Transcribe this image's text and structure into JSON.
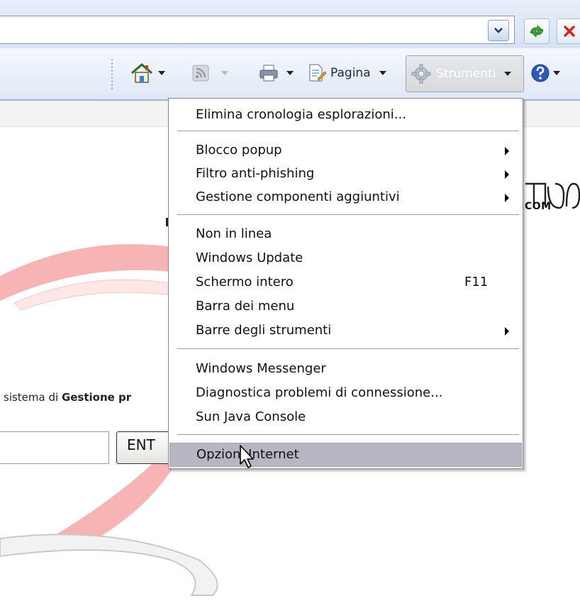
{
  "toolbar": {
    "page_label": "Pagina",
    "tools_label": "Strumenti"
  },
  "page": {
    "text_prefix": "sistema di ",
    "text_bold": "Gestione pr",
    "enter_button": "ENT",
    "logo_text": "COM"
  },
  "menu": {
    "items": [
      {
        "label": "Elimina cronologia esplorazioni..."
      },
      {
        "label": "Blocco popup"
      },
      {
        "label": "Filtro anti-phishing"
      },
      {
        "label": "Gestione componenti aggiuntivi"
      },
      {
        "label": "Non in linea"
      },
      {
        "label": "Windows Update"
      },
      {
        "label": "Schermo intero",
        "accel": "F11"
      },
      {
        "label": "Barra dei menu"
      },
      {
        "label": "Barre degli strumenti"
      },
      {
        "label": "Windows Messenger"
      },
      {
        "label": "Diagnostica problemi di connessione..."
      },
      {
        "label": "Sun Java Console"
      },
      {
        "label": "Opzioni Internet"
      }
    ]
  }
}
